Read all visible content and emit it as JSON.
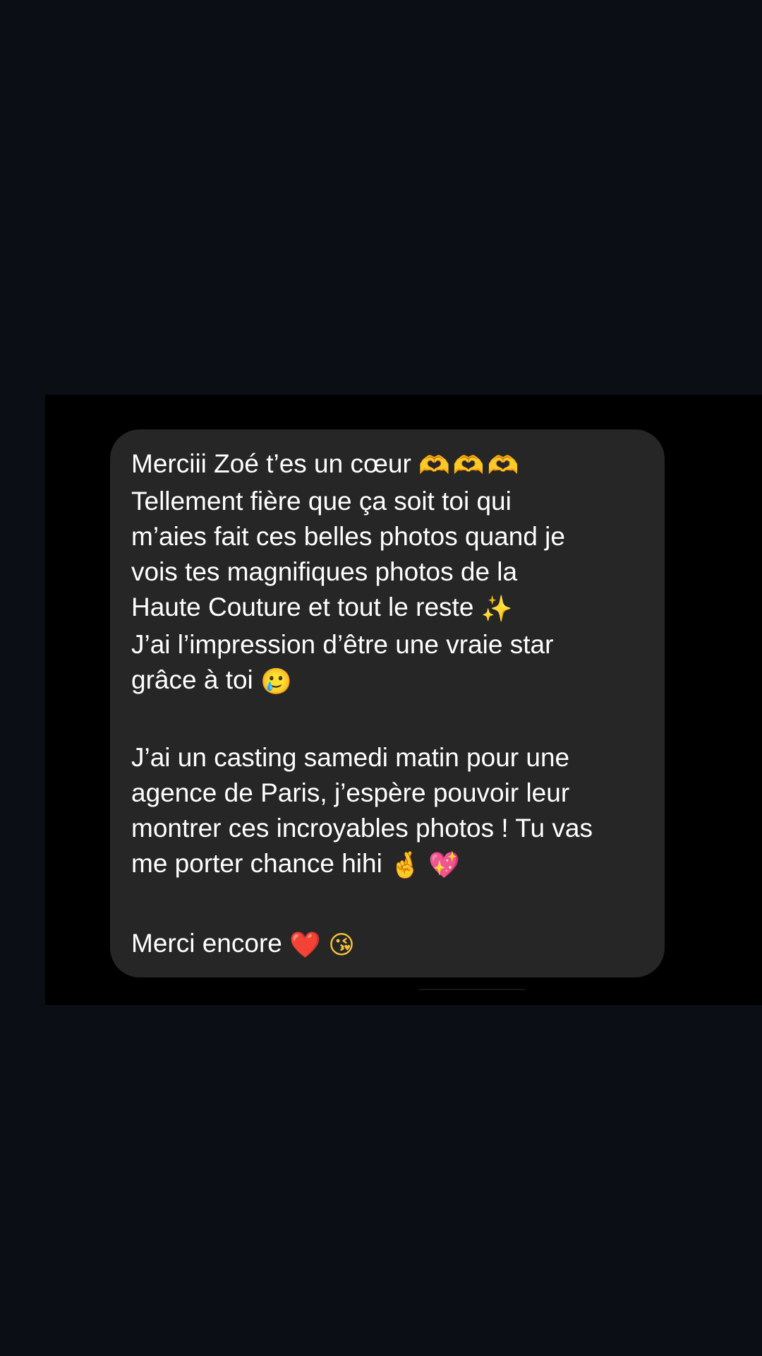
{
  "message": {
    "p1": {
      "l1_text": "Merciii Zoé t’es un cœur",
      "l1_emoji": "🫶🫶🫶",
      "l2": "Tellement fière que ça soit toi qui",
      "l3": "m’aies fait ces belles photos quand je",
      "l4": "vois tes magnifiques photos de la",
      "l5_text": "Haute Couture et tout le reste",
      "l5_emoji": "✨",
      "l6": "J’ai l’impression d’être une vraie star",
      "l7_text": "grâce à toi",
      "l7_emoji": "🥲"
    },
    "p2": {
      "l1": "J’ai un casting samedi matin pour une",
      "l2": "agence de Paris, j’espère pouvoir leur",
      "l3": "montrer ces incroyables photos ! Tu vas",
      "l4_text": "me porter chance hihi",
      "l4_emoji_1": "🤞",
      "l4_emoji_2": "💖"
    },
    "p3": {
      "l1_text": "Merci encore",
      "l1_emoji_1": "❤️",
      "l1_emoji_2": "😘"
    }
  },
  "colors": {
    "page_background": "#0b0e15",
    "panel_background": "#000000",
    "bubble_background": "#262626",
    "text": "#ffffff"
  }
}
